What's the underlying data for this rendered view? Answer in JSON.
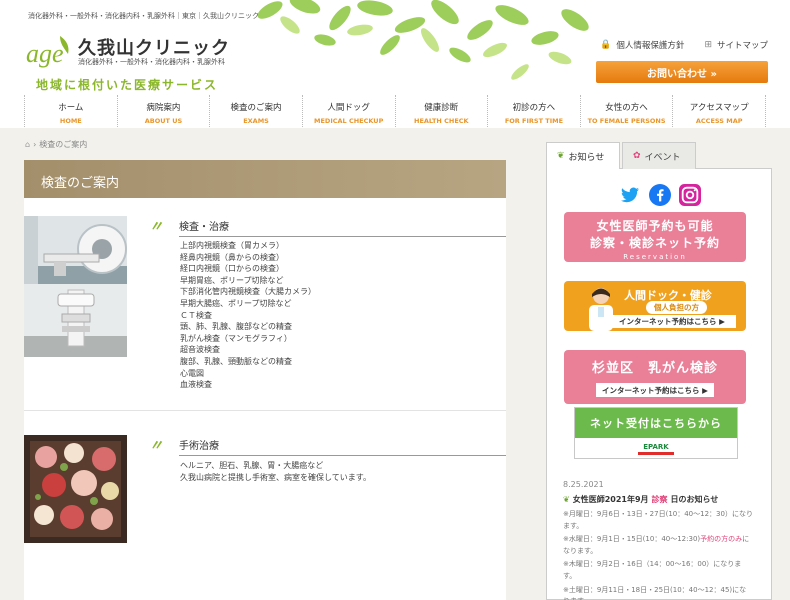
{
  "header": {
    "breadcrumb": "消化器外科・一般外科・消化器内科・乳腺外科｜東京｜久我山クリニック",
    "logo_mark": "age",
    "logo_name": "久我山クリニック",
    "logo_sub": "消化器外科・一般外科・消化器内科・乳腺外科",
    "slogan": "地域に根付いた医療サービス",
    "links": [
      {
        "label": "個人情報保護方針",
        "icon": "lock-icon"
      },
      {
        "label": "サイトマップ",
        "icon": "sitemap-icon"
      }
    ],
    "contact_button": "お問い合わせ »"
  },
  "nav": [
    {
      "ja": "ホーム",
      "en": "HOME"
    },
    {
      "ja": "病院案内",
      "en": "ABOUT US"
    },
    {
      "ja": "検査のご案内",
      "en": "EXAMS"
    },
    {
      "ja": "人間ドッグ",
      "en": "MEDICAL CHECKUP"
    },
    {
      "ja": "健康診断",
      "en": "HEALTH CHECK"
    },
    {
      "ja": "初診の方へ",
      "en": "FOR FIRST TIME"
    },
    {
      "ja": "女性の方へ",
      "en": "TO FEMALE PERSONS"
    },
    {
      "ja": "アクセスマップ",
      "en": "ACCESS MAP"
    }
  ],
  "crumb": "検査のご案内",
  "page_title": "検査のご案内",
  "sections": [
    {
      "quote": "〃",
      "title": "検査・治療",
      "items": [
        "上部内視鏡検査（胃カメラ）",
        "経鼻内視鏡（鼻からの検査）",
        "経口内視鏡（口からの検査）",
        "早期胃癌、ポリープ切除など",
        "下部消化管内視鏡検査（大腸カメラ）",
        "早期大腸癌、ポリープ切除など",
        "ＣＴ検査",
        "頭、肺、乳腺、腹部などの精査",
        "乳がん検査（マンモグラフィ）",
        "超音波検査",
        "腹部、乳腺、頸動脈などの精査",
        "心電図",
        "血液検査"
      ]
    },
    {
      "quote": "〃",
      "title": "手術治療",
      "items": [
        "ヘルニア、胆石、乳腺、胃・大腸癌など",
        "久我山病院と提携し手術室、病室を確保しています。"
      ]
    }
  ],
  "sidebar": {
    "tabs": [
      {
        "label": "お知らせ",
        "icon": "leaf-icon"
      },
      {
        "label": "イベント",
        "icon": "paw-icon"
      }
    ],
    "social": [
      "twitter-icon",
      "facebook-icon",
      "instagram-icon"
    ],
    "banner1": {
      "l1": "女性医師予約も可能",
      "l2": "診察・検診ネット予約",
      "l3": "Reservation"
    },
    "banner2": {
      "title": "人間ドック・健診",
      "sub": "個人負担の方",
      "button": "インターネット予約はこちら ▶"
    },
    "banner3": {
      "title": "杉並区　乳がん検診",
      "button": "インターネット予約はこちら ▶"
    },
    "banner4": {
      "title": "ネット受付はこちらから",
      "brand": "EPARK"
    },
    "news": {
      "date": "8.25.2021",
      "title_a": "女性医師2021年9月",
      "title_b": "診察",
      "title_c": "日のお知らせ",
      "items": [
        {
          "text": "※月曜日：9月6日・13日・27日(10：40～12：30）になります。"
        },
        {
          "a": "※水曜日：9月1日・15日(10：40～12:30)",
          "b": "予約の方のみ",
          "c": "になります。"
        },
        {
          "text": "※木曜日：9月2日・16日（14：00～16：00）になります。"
        },
        {
          "text": "※土曜日：9月11日・18日・25日(10：40～12：45)になります。"
        }
      ]
    }
  },
  "colors": {
    "accent_green": "#8bb72b",
    "orange": "#e57a0d",
    "pink": "#ea7f98",
    "title_bar": "#a48f6b"
  }
}
